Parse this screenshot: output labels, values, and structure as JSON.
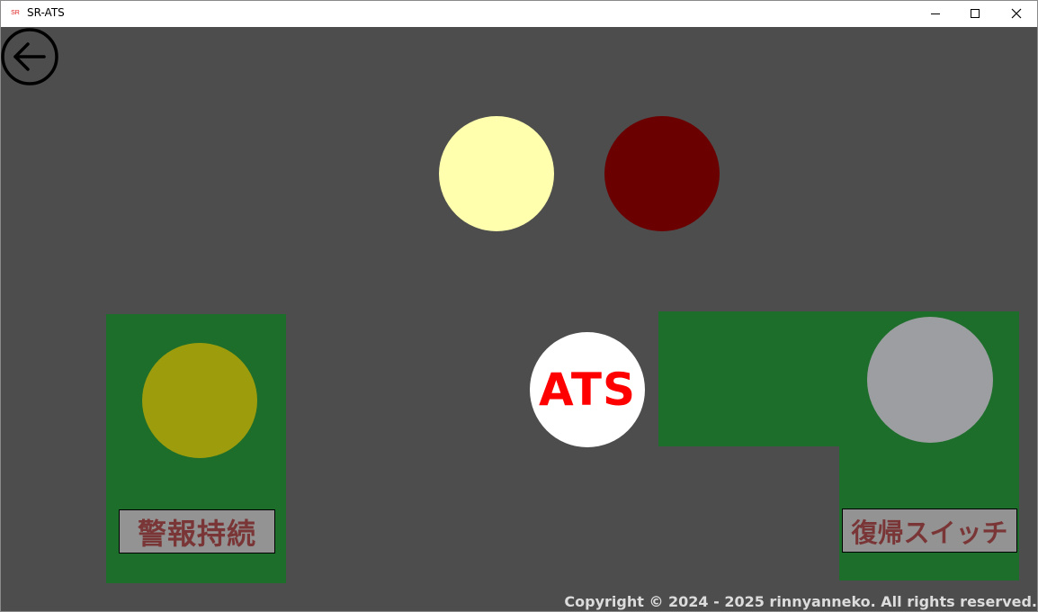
{
  "window": {
    "title": "SR-ATS",
    "app_icon_glyph": "SR",
    "buttons": [
      "minimize",
      "maximize",
      "close"
    ]
  },
  "icons": {
    "back": "arrow-left-circle-icon"
  },
  "indicators": {
    "top_left_lamp_color": "#ffffad",
    "top_right_lamp_color": "#6b0000",
    "warning_lamp_color": "#9c9c0d",
    "reset_lamp_color": "#9c9ea2"
  },
  "ats": {
    "label": "ATS",
    "label_color": "#ff0000"
  },
  "buttons": {
    "warning_continue": "警報持続",
    "reset_switch": "復帰スイッチ"
  },
  "colors": {
    "background": "#4d4d4d",
    "panel": "#1c6e2a",
    "button_text": "#7a3636"
  },
  "footer": {
    "copyright": "Copyright © 2024 - 2025 rinnyanneko. All rights reserved."
  }
}
